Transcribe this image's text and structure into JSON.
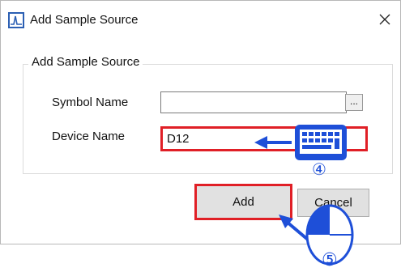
{
  "dialog": {
    "title": "Add Sample Source",
    "close_symbol": "×"
  },
  "group": {
    "legend": "Add Sample Source",
    "symbol_name_label": "Symbol Name",
    "symbol_name_value": "",
    "browse_label": "...",
    "device_name_label": "Device Name",
    "device_name_value": "D12"
  },
  "buttons": {
    "add": "Add",
    "cancel": "Cancel"
  },
  "annotations": {
    "step4": "④",
    "step5": "⑤",
    "accent_color": "#1e4fd8",
    "highlight_color": "#e01f26",
    "keyboard_icon": "keyboard-icon",
    "mouse_icon": "mouse-icon"
  }
}
